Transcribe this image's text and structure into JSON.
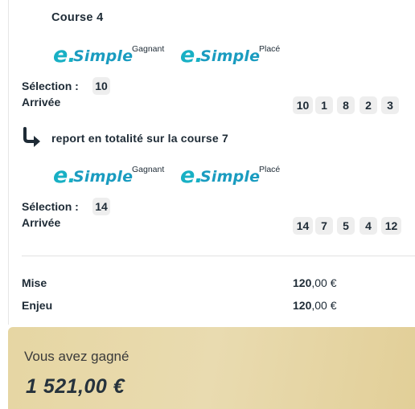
{
  "course": {
    "title": "Course 4"
  },
  "bet_logo": {
    "prefix": "e.",
    "brand": "Simple"
  },
  "bet_types": {
    "win": "Gagnant",
    "place": "Placé"
  },
  "labels": {
    "selection": "Sélection :",
    "arrivee": "Arrivée"
  },
  "first": {
    "selection": "10",
    "arrival": [
      "10",
      "1",
      "8",
      "2",
      "3"
    ]
  },
  "report": {
    "text": "report en totalité sur la course 7"
  },
  "second": {
    "selection": "14",
    "arrival": [
      "14",
      "7",
      "5",
      "4",
      "12"
    ]
  },
  "summary": {
    "mise_label": "Mise",
    "mise_int": "120",
    "mise_dec": ",00 €",
    "enjeu_label": "Enjeu",
    "enjeu_int": "120",
    "enjeu_dec": ",00 €"
  },
  "win": {
    "label": "Vous avez gagné",
    "amount": "1 521,00 €"
  },
  "colors": {
    "brand_cyan": "#18b0c4",
    "gold_panel": "#e6d6a3",
    "chip_bg": "#eeeeee"
  },
  "icons": {
    "report": "curved-arrow-right-icon"
  }
}
